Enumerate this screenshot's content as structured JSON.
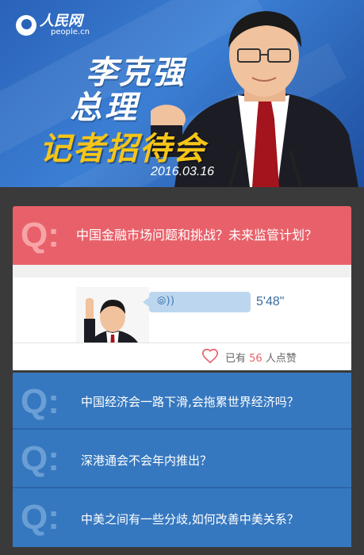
{
  "header": {
    "logo_cn": "人民网",
    "logo_en": "people.cn",
    "title_line1": "李克强",
    "title_line2": "总理",
    "title_line3": "记者招待会",
    "date": "2016.03.16"
  },
  "questions": [
    {
      "mark": "Q:",
      "text": "中国金融市场问题和挑战？未来监管计划？",
      "active": true
    },
    {
      "mark": "Q:",
      "text": "中国经济会一路下滑,会拖累世界经济吗？",
      "active": false
    },
    {
      "mark": "Q:",
      "text": "深港通会不会年内推出？",
      "active": false
    },
    {
      "mark": "Q:",
      "text": "中美之间有一些分歧,如何改善中美关系？",
      "active": false
    }
  ],
  "answer": {
    "audio_icon": "audio-wave-icon",
    "duration": "5'48\"",
    "likes_prefix": "已有",
    "likes_count": "56",
    "likes_suffix": "人点赞"
  },
  "colors": {
    "active_question": "#e8616a",
    "inactive_question": "#3678bf",
    "title_accent": "#f5c518"
  }
}
